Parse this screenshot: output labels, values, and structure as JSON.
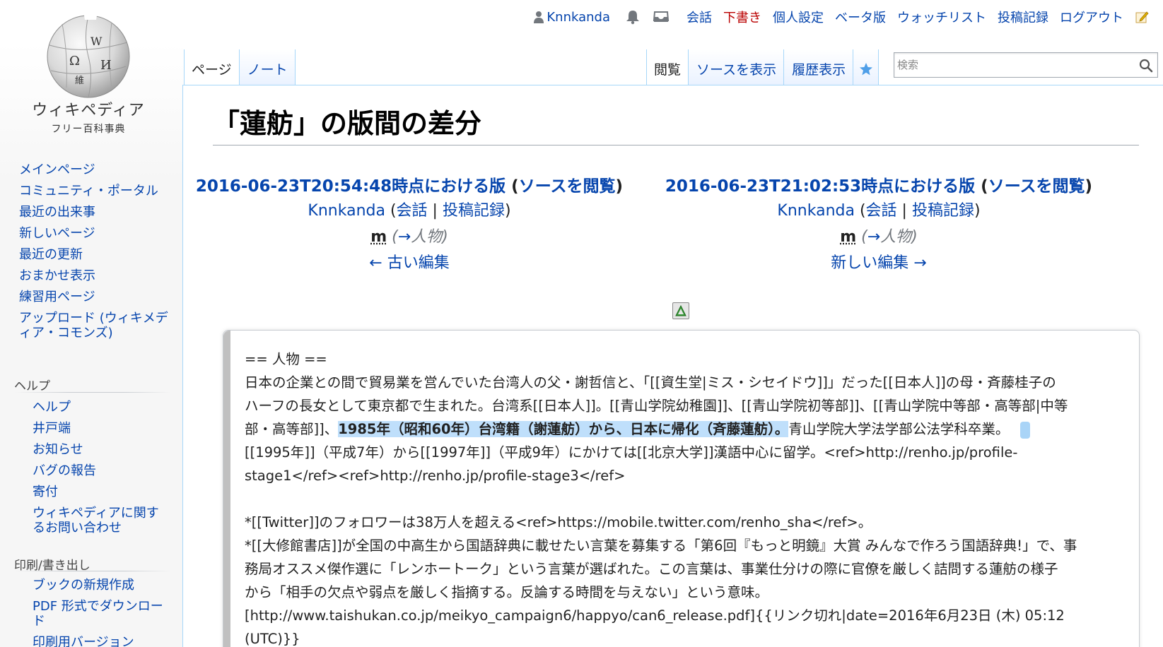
{
  "logo": {
    "title": "ウィキペディア",
    "tagline": "フリー百科事典",
    "glyphs": [
      "Ω",
      "W",
      "И",
      "維"
    ]
  },
  "sidebar": {
    "main_items": [
      "メインページ",
      "コミュニティ・ポータル",
      "最近の出来事",
      "新しいページ",
      "最近の更新",
      "おまかせ表示",
      "練習用ページ",
      "アップロード (ウィキメディア・コモンズ)"
    ],
    "help_heading": "ヘルプ",
    "help_items": [
      "ヘルプ",
      "井戸端",
      "お知らせ",
      "バグの報告",
      "寄付",
      "ウィキペディアに関するお問い合わせ"
    ],
    "print_heading": "印刷/書き出し",
    "print_items": [
      "ブックの新規作成",
      "PDF 形式でダウンロード",
      "印刷用バージョン"
    ]
  },
  "personal": {
    "username": "Knnkanda",
    "links": [
      "会話",
      "下書き",
      "個人設定",
      "ベータ版",
      "ウォッチリスト",
      "投稿記録",
      "ログアウト"
    ]
  },
  "tabs": {
    "page": "ページ",
    "talk": "ノート",
    "read": "閲覧",
    "view_source": "ソースを表示",
    "history": "履歴表示"
  },
  "search": {
    "placeholder": "検索",
    "value": ""
  },
  "page_title": "「蓮舫」の版間の差分",
  "diff": {
    "left": {
      "title": "2016-06-23T20:54:48時点における版",
      "paren_open": " (",
      "source_link": "ソースを閲覧",
      "paren_close": ")",
      "user": "Knnkanda",
      "talk": "会話",
      "contribs": "投稿記録",
      "minor_flag": "m",
      "summary_arrow": "→",
      "summary_section": "人物",
      "nav": "← 古い編集"
    },
    "right": {
      "title": "2016-06-23T21:02:53時点における版",
      "paren_open": " (",
      "source_link": "ソースを閲覧",
      "paren_close": ")",
      "user": "Knnkanda",
      "talk": "会話",
      "contribs": "投稿記録",
      "minor_flag": "m",
      "summary_arrow": "→",
      "summary_section": "人物",
      "nav": "新しい編集 →"
    },
    "toggle_symbol": "Δ",
    "lines": {
      "l1": "== 人物 ==",
      "l2": "日本の企業との間で貿易業を営んでいた台湾人の父・謝哲信と、「[[資生堂|ミス・シセイドウ]]」だった[[日本人]]の母・斉藤桂子の",
      "l3": "ハーフの長女として東京都で生まれた。台湾系[[日本人]]。[[青山学院幼稚園]]、[[青山学院初等部]]、[[青山学院中等部・高等部|中等",
      "l4_pre": "部・高等部]]、",
      "l4_hl": "1985年（昭和60年）台湾籍（謝蓮舫）から、日本に帰化（斉藤蓮舫）。",
      "l4_post": "青山学院大学法学部公法学科卒業。",
      "l5": "[[1995年]]（平成7年）から[[1997年]]（平成9年）にかけては[[北京大学]]漢語中心に留学。<ref>http://renho.jp/profile-",
      "l6": "stage1</ref><ref>http://renho.jp/profile-stage3</ref>",
      "l7": "*[[Twitter]]のフォロワーは38万人を超える<ref>https://mobile.twitter.com/renho_sha</ref>。",
      "l8": "*[[大修館書店]]が全国の中高生から国語辞典に載せたい言葉を募集する「第6回『もっと明鏡』大賞 みんなで作ろう国語辞典!」で、事",
      "l9": "務局オススメ傑作選に「レンホートーク」という言葉が選ばれた。この言葉は、事業仕分けの際に官僚を厳しく詰問する蓮舫の様子",
      "l10": "から「相手の欠点や弱点を厳しく指摘する。反論する時間を与えない」という意味。",
      "l11": "[http://www.taishukan.co.jp/meikyo_campaign6/happyo/can6_release.pdf]{{リンク切れ|date=2016年6月23日 (木) 05:12",
      "l12": "(UTC)}}"
    }
  },
  "colors": {
    "link": "#0645ad",
    "redlink": "#ba0000",
    "diff_added_highlight": "#bfdffb",
    "tab_border": "#a7d7f9"
  }
}
